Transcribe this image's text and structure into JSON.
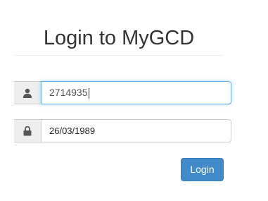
{
  "page": {
    "title": "Login to MyGCD"
  },
  "form": {
    "username": {
      "value": "2714935",
      "icon": "user-icon"
    },
    "password": {
      "value": "26/03/1989",
      "icon": "lock-icon"
    },
    "login_label": "Login"
  },
  "colors": {
    "accent": "#428bca",
    "focus_border": "#66afe9",
    "addon_bg": "#eeeeee"
  }
}
